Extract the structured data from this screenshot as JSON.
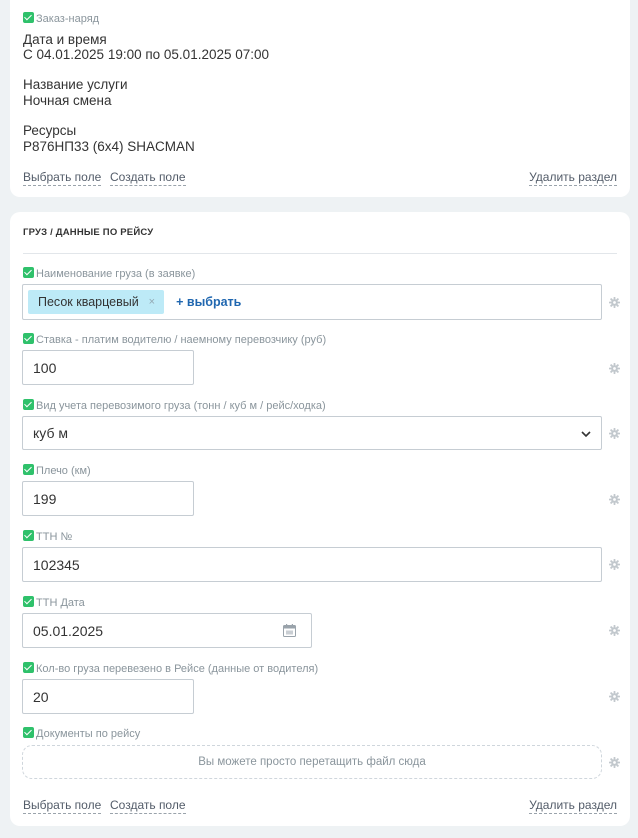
{
  "order_card": {
    "badge": "Заказ-наряд",
    "fields": [
      {
        "label": "Дата и время",
        "value": "С 04.01.2025 19:00 по 05.01.2025 07:00"
      },
      {
        "label": "Название услуги",
        "value": "Ночная смена"
      },
      {
        "label": "Ресурсы",
        "value": "Р876НП33 (6х4) SHACMAN"
      }
    ],
    "actions": {
      "select_field": "Выбрать поле",
      "create_field": "Создать поле",
      "delete_section": "Удалить раздел"
    }
  },
  "cargo_card": {
    "title": "ГРУЗ / ДАННЫЕ ПО РЕЙСУ",
    "cargo_name": {
      "label": "Наименование груза (в заявке)",
      "tag": "Песок кварцевый",
      "tag_remove": "×",
      "add_label": "+ выбрать"
    },
    "rate": {
      "label": "Ставка - платим водителю / наемному перевозчику (руб)",
      "value": "100"
    },
    "accounting": {
      "label": "Вид учета перевозимого груза (тонн / куб м / рейс/ходка)",
      "value": "куб м"
    },
    "distance": {
      "label": "Плечо (км)",
      "value": "199"
    },
    "ttn_number": {
      "label": "ТТН №",
      "value": "102345"
    },
    "ttn_date": {
      "label": "ТТН Дата",
      "value": "05.01.2025"
    },
    "cargo_amount": {
      "label": "Кол-во груза перевезено в Рейсе (данные от водителя)",
      "value": "20"
    },
    "documents": {
      "label": "Документы по рейсу",
      "drop_text": "Вы можете просто перетащить файл сюда"
    },
    "actions": {
      "select_field": "Выбрать поле",
      "create_field": "Создать поле",
      "delete_section": "Удалить раздел"
    }
  },
  "icons": {
    "check": "check-icon",
    "gear": "gear-icon",
    "chevron": "chevron-down-icon",
    "calendar": "calendar-icon"
  },
  "colors": {
    "check": "#2fc16b",
    "tag_bg": "#bdeaf7",
    "link_blue": "#2067b0",
    "page_bg": "#eef2f4"
  }
}
